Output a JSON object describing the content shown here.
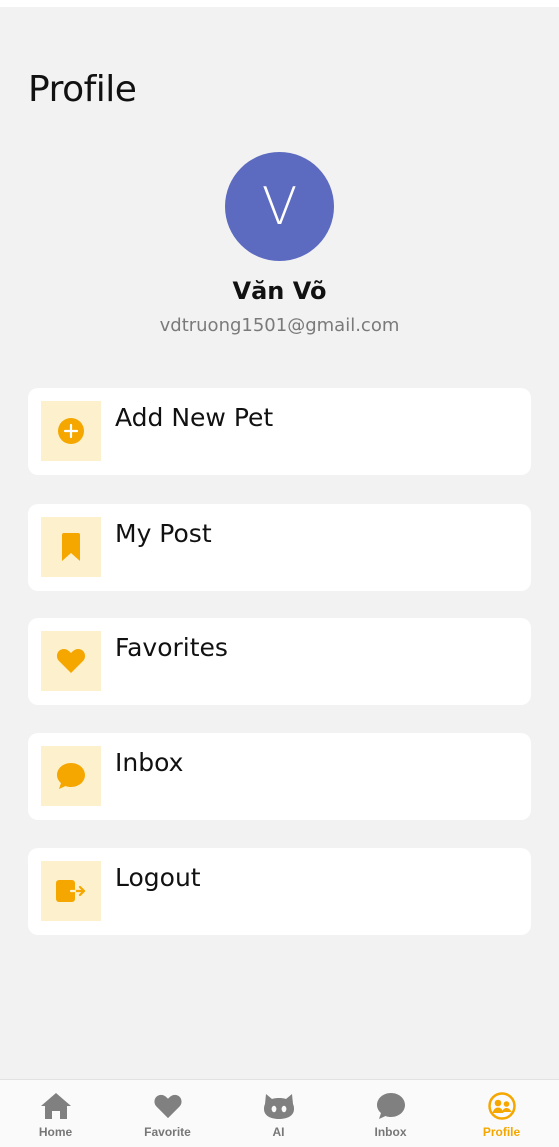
{
  "header": {
    "title": "Profile"
  },
  "user": {
    "initial": "V",
    "name": "Văn Võ",
    "email": "vdtruong1501@gmail.com",
    "avatar_color": "#5c6bc0"
  },
  "menu": {
    "items": [
      {
        "label": "Add New Pet",
        "icon": "add-circle-icon"
      },
      {
        "label": "My Post",
        "icon": "bookmark-icon"
      },
      {
        "label": "Favorites",
        "icon": "heart-icon"
      },
      {
        "label": "Inbox",
        "icon": "chat-bubble-icon"
      },
      {
        "label": "Logout",
        "icon": "logout-icon"
      }
    ]
  },
  "nav": {
    "active": "Profile",
    "items": [
      {
        "label": "Home",
        "icon": "home-icon"
      },
      {
        "label": "Favorite",
        "icon": "heart-icon"
      },
      {
        "label": "AI",
        "icon": "github-cat-icon"
      },
      {
        "label": "Inbox",
        "icon": "chat-bubble-icon"
      },
      {
        "label": "Profile",
        "icon": "people-icon"
      }
    ]
  },
  "colors": {
    "accent": "#f5a700",
    "icon_bg": "#fdf0cc",
    "background": "#f2f2f2",
    "nav_inactive": "#777777"
  }
}
